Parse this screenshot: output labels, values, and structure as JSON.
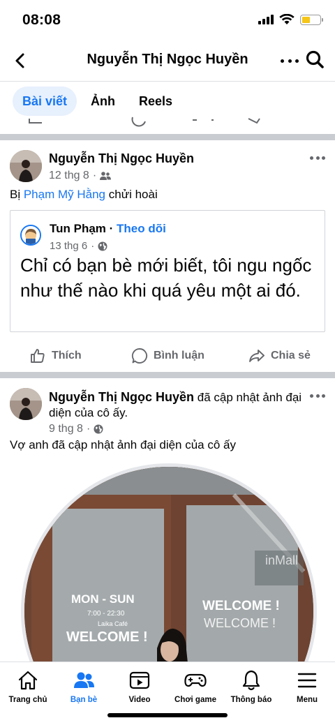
{
  "status_bar": {
    "time": "08:08"
  },
  "header": {
    "title": "Nguyễn Thị Ngọc Huyền"
  },
  "tabs": [
    {
      "label": "Bài viết",
      "active": true
    },
    {
      "label": "Ảnh",
      "active": false
    },
    {
      "label": "Reels",
      "active": false
    }
  ],
  "post1": {
    "author": "Nguyễn Thị Ngọc Huyền",
    "time": "12 thg 8",
    "privacy_icon": "friends-icon",
    "text_prefix": "Bị ",
    "mention": "Phạm Mỹ Hằng",
    "text_suffix": " chửi hoài",
    "shared": {
      "author": "Tun Phạm",
      "separator": " · ",
      "follow_label": "Theo dõi",
      "time": "13 thg 6",
      "privacy_icon": "globe-icon",
      "quote": "Chỉ có bạn bè mới biết, tôi ngu ngốc như thế nào khi quá yêu một ai đó."
    },
    "actions": {
      "like": "Thích",
      "comment": "Bình luận",
      "share": "Chia sẻ"
    }
  },
  "post2": {
    "author": "Nguyễn Thị Ngọc Huyền",
    "action_text": " đã cập nhật ảnh đại diện của cô ấy.",
    "time": "9 thg 8",
    "privacy_icon": "globe-icon",
    "text": "Vợ anh đã cập nhật ảnh đại diện của cô ấy",
    "photo_text": {
      "mon_sun": "MON - SUN",
      "hours": "7:00 - 22:30",
      "cafe": "Laika Café",
      "welcome_left": "WELCOME !",
      "welcome_right_1": "WELCOME !",
      "welcome_right_2": "WELCOME !",
      "sign": "inMall"
    }
  },
  "bottom_nav": [
    {
      "label": "Trang chủ",
      "icon": "home-icon"
    },
    {
      "label": "Bạn bè",
      "icon": "friends-icon",
      "active": true
    },
    {
      "label": "Video",
      "icon": "video-icon"
    },
    {
      "label": "Chơi game",
      "icon": "gamepad-icon"
    },
    {
      "label": "Thông báo",
      "icon": "bell-icon"
    },
    {
      "label": "Menu",
      "icon": "menu-icon"
    }
  ],
  "colors": {
    "accent": "#1877f2",
    "secondary_text": "#65676b",
    "separator": "#c9ccd1"
  }
}
